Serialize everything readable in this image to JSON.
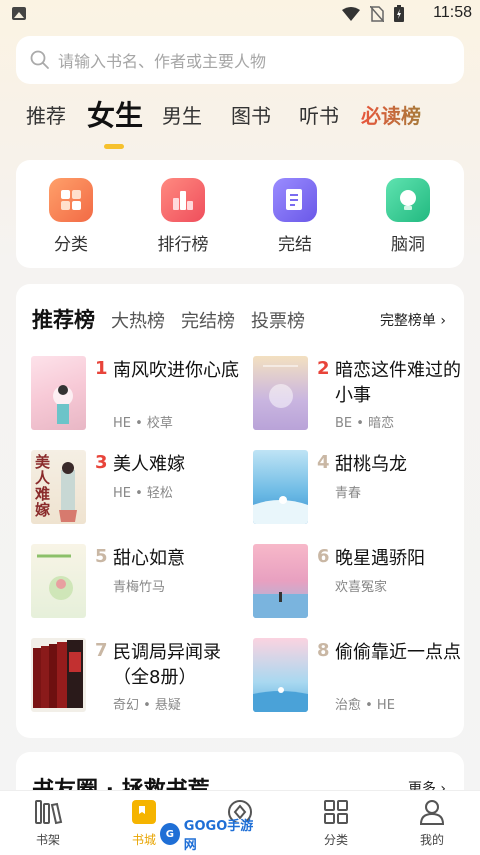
{
  "status_bar": {
    "time": "11:58"
  },
  "search": {
    "placeholder": "请输入书名、作者或主要人物"
  },
  "tabs": [
    {
      "label": "推荐"
    },
    {
      "label": "女生",
      "active": true
    },
    {
      "label": "男生"
    },
    {
      "label": "图书"
    },
    {
      "label": "听书"
    },
    {
      "label": "必读榜"
    }
  ],
  "quick_links": [
    {
      "label": "分类",
      "icon": "category-icon",
      "color": "#f47c52"
    },
    {
      "label": "排行榜",
      "icon": "ranking-icon",
      "color": "#f4606a"
    },
    {
      "label": "完结",
      "icon": "document-icon",
      "color": "#7a6cf0"
    },
    {
      "label": "脑洞",
      "icon": "bulb-icon",
      "color": "#3ccf96"
    }
  ],
  "ranking": {
    "title": "推荐榜",
    "subtabs": [
      "大热榜",
      "完结榜",
      "投票榜"
    ],
    "more": "完整榜单",
    "books": [
      {
        "rank": "1",
        "title": "南风吹进你心底",
        "meta": "HE • 校草"
      },
      {
        "rank": "2",
        "title": "暗恋这件难过的小事",
        "meta": "BE • 暗恋"
      },
      {
        "rank": "3",
        "title": "美人难嫁",
        "meta": "HE • 轻松",
        "cover_text": "美人难嫁"
      },
      {
        "rank": "4",
        "title": "甜桃乌龙",
        "meta": "青春"
      },
      {
        "rank": "5",
        "title": "甜心如意",
        "meta": "青梅竹马"
      },
      {
        "rank": "6",
        "title": "晚星遇骄阳",
        "meta": "欢喜冤家"
      },
      {
        "rank": "7",
        "title": "民调局异闻录（全8册）",
        "meta": "奇幻 • 悬疑"
      },
      {
        "rank": "8",
        "title": "偷偷靠近一点点",
        "meta": "治愈 • HE"
      }
    ],
    "rank_colors": {
      "top": "#e8443a",
      "rest": "#c9b7a4"
    }
  },
  "teaser": {
    "title": "书友圈 · 拯救书荒",
    "more": "更多"
  },
  "bottom_nav": [
    {
      "label": "书架",
      "icon": "bookshelf-icon"
    },
    {
      "label": "书城",
      "icon": "bookstore-icon",
      "active": true
    },
    {
      "label": "福利",
      "icon": "gift-icon"
    },
    {
      "label": "分类",
      "icon": "grid-icon"
    },
    {
      "label": "我的",
      "icon": "person-icon"
    }
  ],
  "watermark": {
    "text": "GOGO手游网"
  }
}
